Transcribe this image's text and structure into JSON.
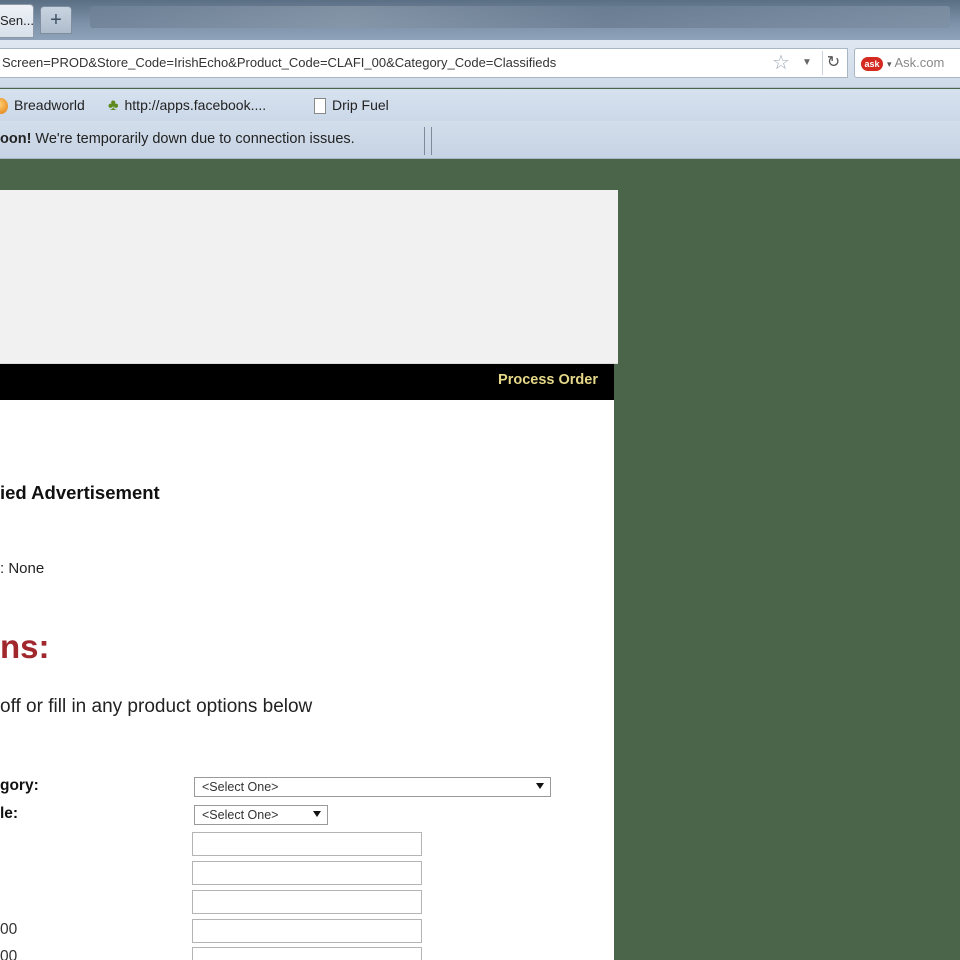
{
  "browser": {
    "active_tab_label": "Sen...",
    "new_tab_label": "+",
    "url": "Screen=PROD&Store_Code=IrishEcho&Product_Code=CLAFI_00&Category_Code=Classifieds",
    "search_placeholder": "Ask.com",
    "search_engine_logo": "ask"
  },
  "bookmarks": [
    {
      "label": "Breadworld",
      "icon": "orange-circle-icon"
    },
    {
      "label": "http://apps.facebook....",
      "icon": "tree-icon"
    },
    {
      "label": "Drip Fuel",
      "icon": "page-icon"
    }
  ],
  "notice": {
    "bold": "oon!",
    "text": " We're temporarily down due to connection issues."
  },
  "store": {
    "process_order": "Process Order"
  },
  "product": {
    "title": "ied Advertisement",
    "price_line": ": None"
  },
  "options": {
    "heading": "ns:",
    "instructions": "off or fill in any product options below",
    "fields": [
      {
        "label": "gory:",
        "type": "select",
        "value": "<Select One>"
      },
      {
        "label": "le:",
        "type": "select",
        "value": "<Select One>"
      },
      {
        "label": "",
        "type": "text",
        "value": ""
      },
      {
        "label": "",
        "type": "text",
        "value": ""
      },
      {
        "label": "",
        "type": "text",
        "value": ""
      },
      {
        "label": "00",
        "type": "text",
        "value": ""
      },
      {
        "label": "00",
        "type": "text",
        "value": ""
      }
    ]
  },
  "colors": {
    "page_background": "#4a6549",
    "heading_red": "#a0272b",
    "process_order_text": "#e5d888"
  }
}
